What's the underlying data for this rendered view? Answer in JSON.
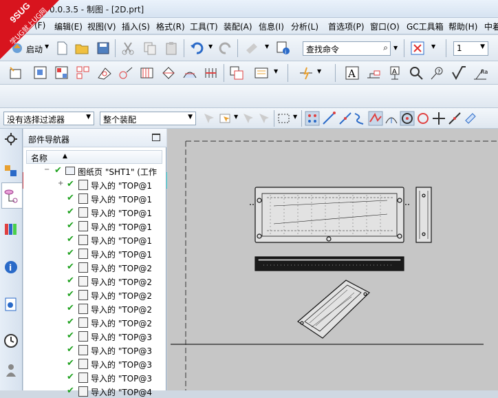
{
  "window": {
    "title": "0.0.3.5 - 制图 - [2D.prt]"
  },
  "watermark": {
    "text_top": "9SUG",
    "text_bottom": "学UG就上UG网"
  },
  "menu": [
    {
      "id": "file",
      "label": "(F)"
    },
    {
      "id": "edit",
      "label": "编辑(E)"
    },
    {
      "id": "view",
      "label": "视图(V)"
    },
    {
      "id": "insert",
      "label": "插入(S)"
    },
    {
      "id": "format",
      "label": "格式(R)"
    },
    {
      "id": "tools",
      "label": "工具(T)"
    },
    {
      "id": "assembly",
      "label": "装配(A)"
    },
    {
      "id": "info",
      "label": "信息(I)"
    },
    {
      "id": "analysis",
      "label": "分析(L)"
    },
    {
      "id": "prefs",
      "label": "首选项(P)"
    },
    {
      "id": "window",
      "label": "窗口(O)"
    },
    {
      "id": "gc",
      "label": "GC工具箱"
    },
    {
      "id": "help",
      "label": "帮助(H)"
    },
    {
      "id": "more",
      "label": "中着"
    }
  ],
  "toolbar": {
    "start_label": "启动",
    "command_search_placeholder": "查找命令",
    "layer_value": "1",
    "filter_value": "没有选择过滤器",
    "assembly_scope_value": "整个装配"
  },
  "colors": [
    "#e8474f",
    "#e646e6",
    "#eca43f",
    "#e8e83c",
    "#c4e060",
    "#4ad04a",
    "#3aa84a",
    "#4ae2e2",
    "#3fa6e6",
    "#3a52e6",
    "#9a6ad8",
    "#a88060",
    "#404040",
    "#989898",
    "#e08aa8",
    "#e47a72",
    "#eab06e",
    "#e0e070",
    "#a8d87e",
    "#8ac88e",
    "#5ab8a8",
    "#52b2c8",
    "#52b8e8"
  ],
  "navigator": {
    "title": "部件导航器",
    "column_name": "名称",
    "root_label": "图纸页 \"SHT1\" (工作",
    "rows": [
      "导入的 \"TOP@1",
      "导入的 \"TOP@1",
      "导入的 \"TOP@1",
      "导入的 \"TOP@1",
      "导入的 \"TOP@1",
      "导入的 \"TOP@1",
      "导入的 \"TOP@2",
      "导入的 \"TOP@2",
      "导入的 \"TOP@2",
      "导入的 \"TOP@2",
      "导入的 \"TOP@2",
      "导入的 \"TOP@3",
      "导入的 \"TOP@3",
      "导入的 \"TOP@3",
      "导入的 \"TOP@3",
      "导入的 \"TOP@4"
    ]
  }
}
